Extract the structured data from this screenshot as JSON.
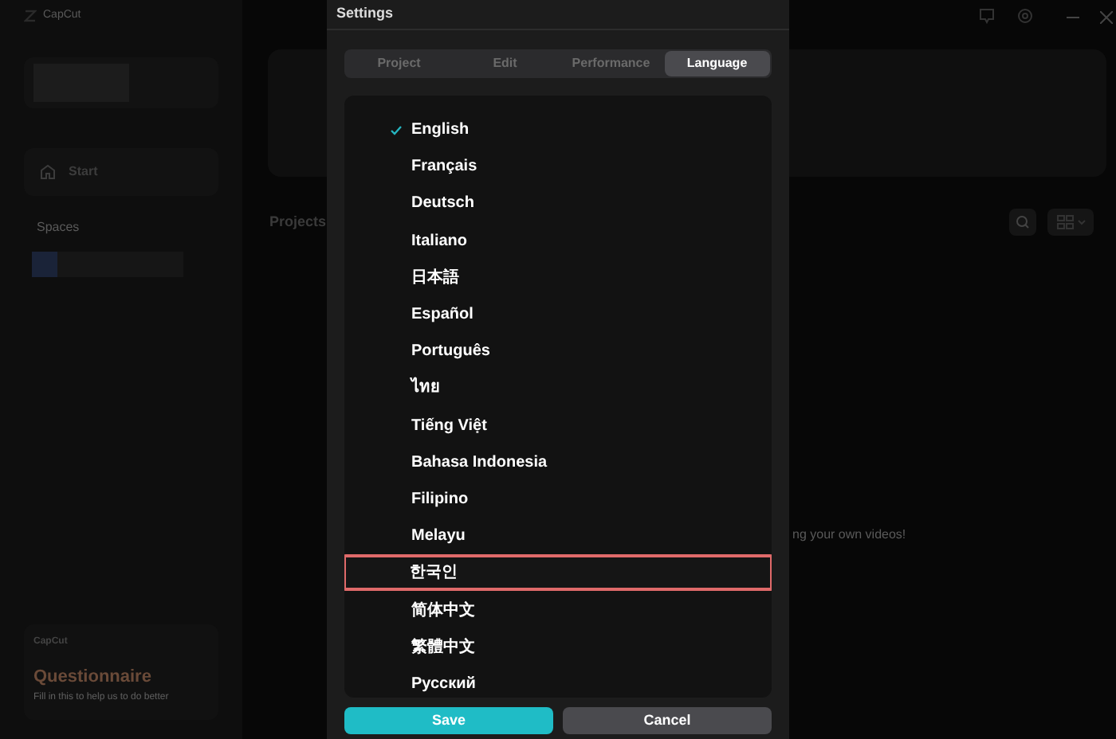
{
  "app": {
    "brand": "CapCut"
  },
  "sidebar": {
    "nav": [
      {
        "label": "Start",
        "selected": true
      }
    ],
    "spaces_heading": "Spaces"
  },
  "main": {
    "projects_heading": "Projects",
    "empty_text": "ng your own videos!"
  },
  "promo": {
    "brand": "CapCut",
    "title": "Questionnaire",
    "text": "Fill in this to help us to do better"
  },
  "dialog": {
    "title": "Settings",
    "tabs": [
      {
        "label": "Project",
        "selected": false
      },
      {
        "label": "Edit",
        "selected": false
      },
      {
        "label": "Performance",
        "selected": false
      },
      {
        "label": "Language",
        "selected": true
      }
    ],
    "languages": [
      {
        "label": "English",
        "selected": true,
        "highlighted": false
      },
      {
        "label": "Français",
        "selected": false,
        "highlighted": false
      },
      {
        "label": "Deutsch",
        "selected": false,
        "highlighted": false
      },
      {
        "label": "Italiano",
        "selected": false,
        "highlighted": false
      },
      {
        "label": "日本語",
        "selected": false,
        "highlighted": false
      },
      {
        "label": "Español",
        "selected": false,
        "highlighted": false
      },
      {
        "label": "Português",
        "selected": false,
        "highlighted": false
      },
      {
        "label": "ไทย",
        "selected": false,
        "highlighted": false
      },
      {
        "label": "Tiếng Việt",
        "selected": false,
        "highlighted": false
      },
      {
        "label": "Bahasa Indonesia",
        "selected": false,
        "highlighted": false
      },
      {
        "label": "Filipino",
        "selected": false,
        "highlighted": false
      },
      {
        "label": "Melayu",
        "selected": false,
        "highlighted": false
      },
      {
        "label": "한국인",
        "selected": false,
        "highlighted": true
      },
      {
        "label": "简体中文",
        "selected": false,
        "highlighted": false
      },
      {
        "label": "繁體中文",
        "selected": false,
        "highlighted": false
      },
      {
        "label": "Русский",
        "selected": false,
        "highlighted": false
      }
    ],
    "buttons": [
      {
        "label": "Save",
        "kind": "primary"
      },
      {
        "label": "Cancel",
        "kind": "secondary"
      }
    ]
  }
}
